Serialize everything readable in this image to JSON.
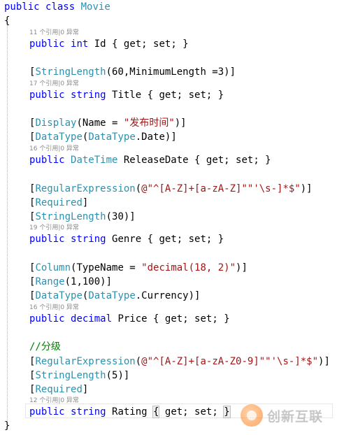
{
  "editor": {
    "class_decl": {
      "kw1": "public",
      "kw2": "class",
      "name": "Movie"
    },
    "open_brace": "{",
    "close_brace": "}",
    "lens": {
      "id": "11 个引用|0 异常",
      "title": "17 个引用|0 异常",
      "release_date": "16 个引用|0 异常",
      "genre": "19 个引用|0 异常",
      "price": "16 个引用|0 异常",
      "rating": "12 个引用|0 异常"
    },
    "lines": {
      "id_prop": {
        "mod": "public",
        "type": "int",
        "name": " Id ",
        "accessors": "{ get; set; }"
      },
      "title_attr": {
        "open": "[",
        "attr": "StringLength",
        "args": "(60,MinimumLength =3)]"
      },
      "title_prop": {
        "mod": "public",
        "type": "string",
        "name": " Title ",
        "accessors": "{ get; set; }"
      },
      "display_attr": {
        "open": "[",
        "attr": "Display",
        "args_pre": "(Name = ",
        "str": "\"发布时间\"",
        "args_post": ")]"
      },
      "datatype_date_attr": {
        "open": "[",
        "attr": "DataType",
        "p1": "(",
        "t": "DataType",
        "p2": ".Date)]"
      },
      "release_prop": {
        "mod": "public",
        "type": "DateTime",
        "name": " ReleaseDate ",
        "accessors": "{ get; set; }"
      },
      "regex1_attr": {
        "open": "[",
        "attr": "RegularExpression",
        "p1": "(",
        "str": "@\"^[A-Z]+[a-zA-Z]\"\"'\\s-]*$\"",
        "p2": ")]"
      },
      "required1_attr": {
        "open": "[",
        "attr": "Required",
        "close": "]"
      },
      "genre_len_attr": {
        "open": "[",
        "attr": "StringLength",
        "args": "(30)]"
      },
      "genre_prop": {
        "mod": "public",
        "type": "string",
        "name": " Genre ",
        "accessors": "{ get; set; }"
      },
      "column_attr": {
        "open": "[",
        "attr": "Column",
        "args_pre": "(TypeName = ",
        "str": "\"decimal(18, 2)\"",
        "args_post": ")]"
      },
      "range_attr": {
        "open": "[",
        "attr": "Range",
        "args": "(1,100)]"
      },
      "datatype_cur_attr": {
        "open": "[",
        "attr": "DataType",
        "p1": "(",
        "t": "DataType",
        "p2": ".Currency)]"
      },
      "price_prop": {
        "mod": "public",
        "type": "decimal",
        "name": " Price ",
        "accessors": "{ get; set; }"
      },
      "comment": "//分级",
      "regex2_attr": {
        "open": "[",
        "attr": "RegularExpression",
        "p1": "(",
        "str": "@\"^[A-Z]+[a-zA-Z0-9]\"\"'\\s-]*$\"",
        "p2": ")]"
      },
      "rating_len_attr": {
        "open": "[",
        "attr": "StringLength",
        "args": "(5)]"
      },
      "required2_attr": {
        "open": "[",
        "attr": "Required",
        "close": "]"
      },
      "rating_prop": {
        "mod": "public",
        "type": "string",
        "name": " Rating ",
        "acc_open": "{",
        "acc_mid": " get; set; ",
        "acc_close": "}"
      }
    }
  },
  "watermark": {
    "text": "创新互联",
    "logo_icon": "chuangxin-logo-icon"
  }
}
